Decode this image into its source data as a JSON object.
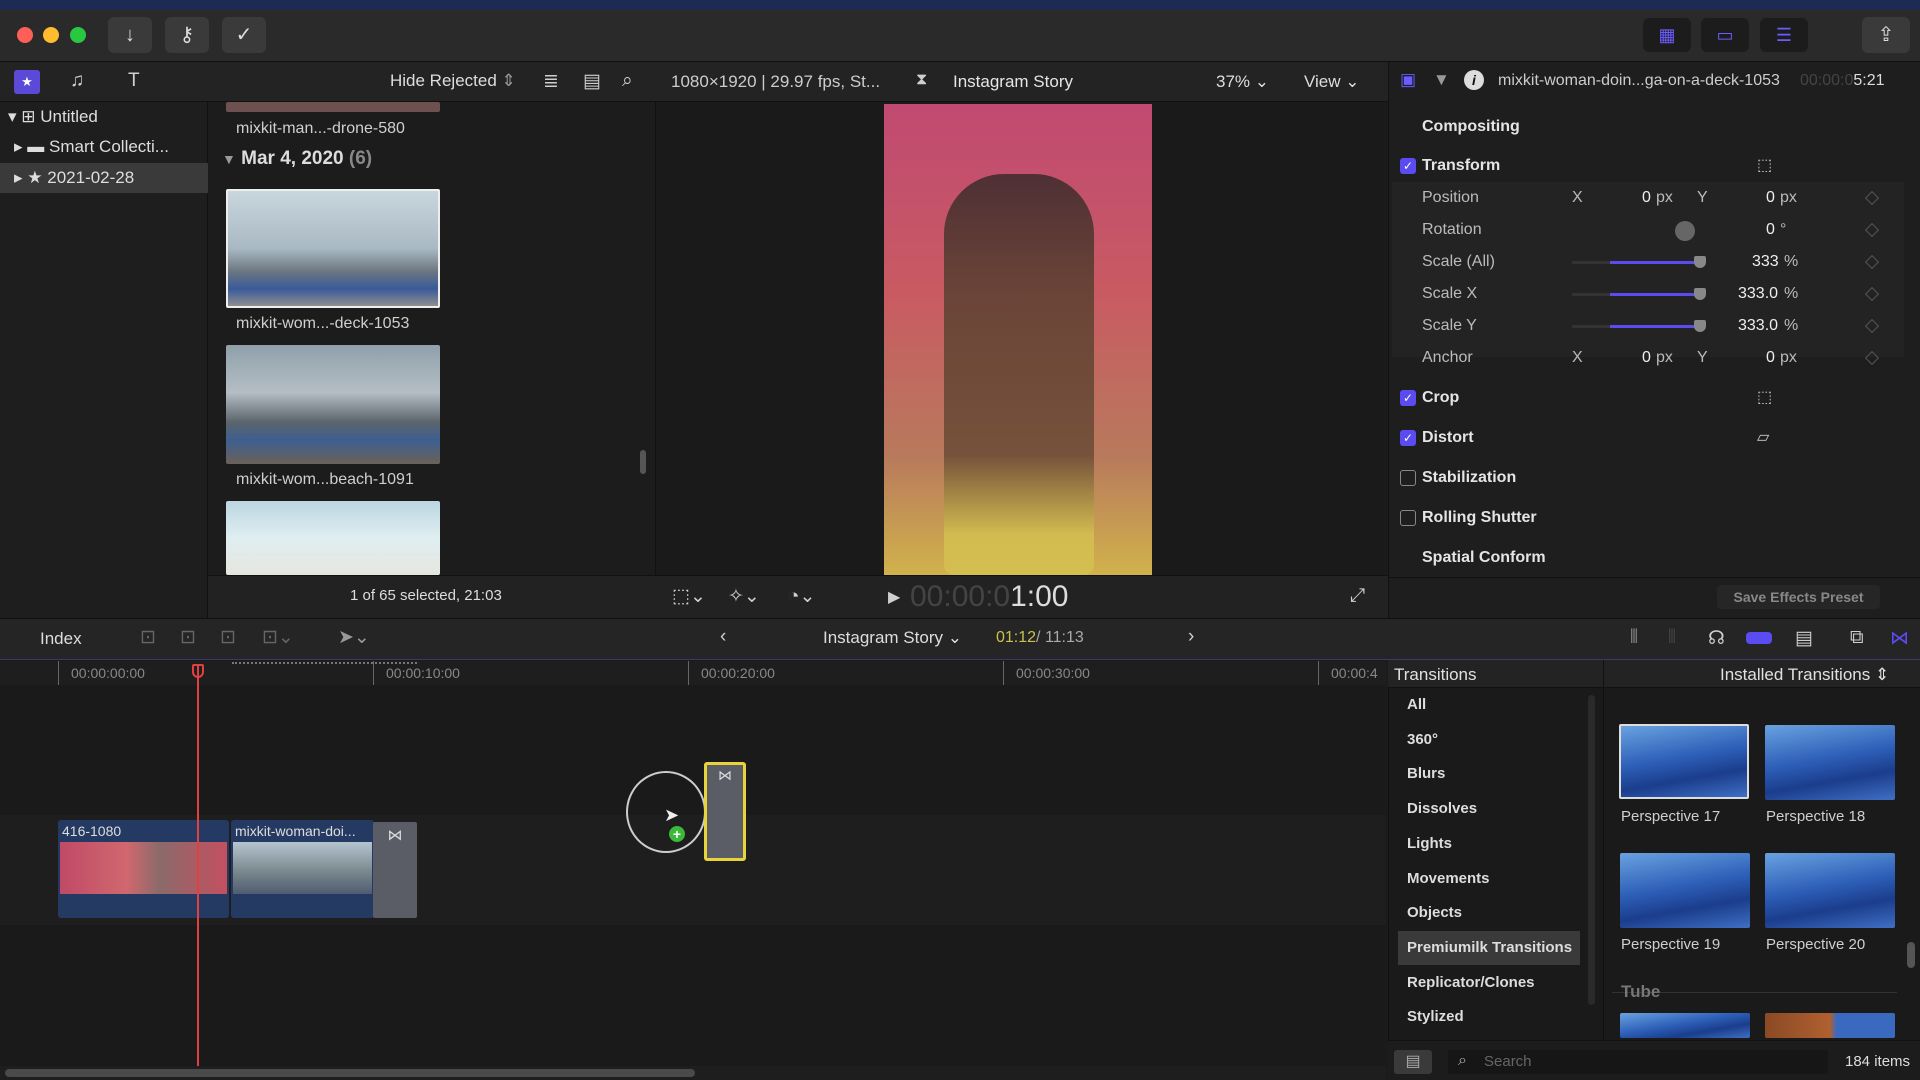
{
  "window": {
    "traffic_lights": [
      "#ff5f57",
      "#febc2e",
      "#28c840"
    ]
  },
  "toolbar": {
    "import_icon": "down-arrow-icon",
    "keywords_icon": "key-icon",
    "background_tasks_icon": "check-circle-icon"
  },
  "browser_bar": {
    "filter": "Hide Rejected",
    "viewer_info": "1080×1920 | 29.97 fps, St...",
    "project_name": "Instagram Story",
    "zoom": "37%",
    "view": "View"
  },
  "library": {
    "items": [
      {
        "label": "Untitled"
      },
      {
        "label": "Smart Collecti..."
      },
      {
        "label": "2021-02-28"
      }
    ]
  },
  "browser": {
    "top_clip": "mixkit-man...-drone-580",
    "date_group": "Mar 4, 2020",
    "date_count": "(6)",
    "clips": [
      {
        "label": "mixkit-wom...-deck-1053"
      },
      {
        "label": "mixkit-wom...beach-1091"
      }
    ],
    "status": "1 of 65 selected, 21:03"
  },
  "viewer": {
    "timecode_dim": "00:00:0",
    "timecode": "1:00"
  },
  "inspector": {
    "clip_name": "mixkit-woman-doin...ga-on-a-deck-1053",
    "duration_dim": "00:00:0",
    "duration": "5:21",
    "compositing": "Compositing",
    "transform": {
      "label": "Transform",
      "enabled": true,
      "position": {
        "label": "Position",
        "x": "0",
        "y": "0",
        "unit": "px"
      },
      "rotation": {
        "label": "Rotation",
        "value": "0",
        "unit": "°"
      },
      "scale_all": {
        "label": "Scale (All)",
        "value": "333",
        "unit": "%"
      },
      "scale_x": {
        "label": "Scale X",
        "value": "333.0",
        "unit": "%"
      },
      "scale_y": {
        "label": "Scale Y",
        "value": "333.0",
        "unit": "%"
      },
      "anchor": {
        "label": "Anchor",
        "x": "0",
        "y": "0",
        "unit": "px"
      },
      "x_label": "X",
      "y_label": "Y"
    },
    "crop": {
      "label": "Crop",
      "enabled": true
    },
    "distort": {
      "label": "Distort",
      "enabled": true
    },
    "stabilization": {
      "label": "Stabilization",
      "enabled": false
    },
    "rolling_shutter": {
      "label": "Rolling Shutter",
      "enabled": false
    },
    "spatial_conform": "Spatial Conform",
    "save_preset": "Save Effects Preset"
  },
  "timeline": {
    "index": "Index",
    "project": "Instagram Story",
    "position": "01:12",
    "total": "/ 11:13",
    "ruler": [
      "00:00:00:00",
      "00:00:10:00",
      "00:00:20:00",
      "00:00:30:00",
      "00:00:4"
    ],
    "clips": [
      {
        "name": "416-1080"
      },
      {
        "name": "mixkit-woman-doi..."
      }
    ]
  },
  "transitions": {
    "title": "Transitions",
    "source": "Installed Transitions",
    "categories": [
      "All",
      "360°",
      "Blurs",
      "Dissolves",
      "Lights",
      "Movements",
      "Objects",
      "Premiumilk Transitions",
      "Replicator/Clones",
      "Stylized"
    ],
    "selected_category": "Premiumilk Transitions",
    "items": [
      "Perspective 17",
      "Perspective 18",
      "Perspective 19",
      "Perspective 20"
    ],
    "next_group": "Tube",
    "search_placeholder": "Search",
    "count": "184 items"
  },
  "colors": {
    "accent": "#5a4cf0",
    "playhead": "#e04040",
    "selection": "#e8d43a",
    "timecode_position": "#c9c24a"
  }
}
